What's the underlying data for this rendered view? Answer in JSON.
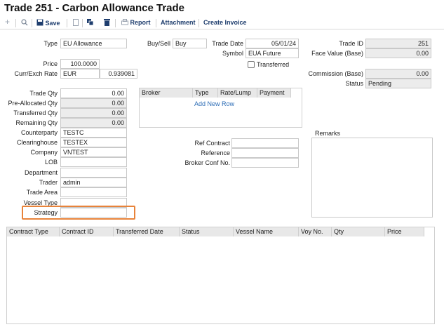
{
  "title": "Trade 251 - Carbon Allowance Trade",
  "toolbar": {
    "save": "Save",
    "report": "Report",
    "attachment": "Attachment",
    "create_invoice": "Create Invoice"
  },
  "fields": {
    "type": {
      "label": "Type",
      "value": "EU Allowance"
    },
    "buy_sell": {
      "label": "Buy/Sell",
      "value": "Buy"
    },
    "trade_date": {
      "label": "Trade Date",
      "value": "05/01/24"
    },
    "trade_id": {
      "label": "Trade ID",
      "value": "251"
    },
    "symbol": {
      "label": "Symbol",
      "value": "EUA Future"
    },
    "face_value": {
      "label": "Face Value (Base)",
      "value": "0.00"
    },
    "transferred": {
      "label": "Transferred",
      "checked": false
    },
    "price": {
      "label": "Price",
      "value": "100.0000"
    },
    "curr_exch": {
      "label": "Curr/Exch Rate",
      "currency": "EUR",
      "rate": "0.939081"
    },
    "commission": {
      "label": "Commission (Base)",
      "value": "0.00"
    },
    "status": {
      "label": "Status",
      "value": "Pending"
    },
    "trade_qty": {
      "label": "Trade Qty",
      "value": "0.00"
    },
    "pre_allocated_qty": {
      "label": "Pre-Allocated Qty",
      "value": "0.00"
    },
    "transferred_qty": {
      "label": "Transferred Qty",
      "value": "0.00"
    },
    "remaining_qty": {
      "label": "Remaining Qty",
      "value": "0.00"
    },
    "counterparty": {
      "label": "Counterparty",
      "value": "TESTC"
    },
    "clearinghouse": {
      "label": "Clearinghouse",
      "value": "TESTEX"
    },
    "company": {
      "label": "Company",
      "value": "VNTEST"
    },
    "lob": {
      "label": "LOB",
      "value": ""
    },
    "department": {
      "label": "Department",
      "value": ""
    },
    "trader": {
      "label": "Trader",
      "value": "admin"
    },
    "trade_area": {
      "label": "Trade Area",
      "value": ""
    },
    "vessel_type": {
      "label": "Vessel Type",
      "value": ""
    },
    "strategy": {
      "label": "Strategy",
      "value": ""
    },
    "ref_contract": {
      "label": "Ref Contract",
      "value": ""
    },
    "reference": {
      "label": "Reference",
      "value": ""
    },
    "broker_conf_no": {
      "label": "Broker Conf No.",
      "value": ""
    }
  },
  "broker_grid": {
    "columns": [
      "Broker",
      "Type",
      "Rate/Lump",
      "Payment"
    ],
    "add_row": "Add New Row"
  },
  "remarks_label": "Remarks",
  "contracts_grid": {
    "columns": [
      "Contract Type",
      "Contract ID",
      "Transferred Date",
      "Status",
      "Vessel Name",
      "Voy No.",
      "Qty",
      "Price"
    ]
  },
  "colors": {
    "highlight": "#e8833a",
    "toolbar_text": "#1f3e6e"
  }
}
